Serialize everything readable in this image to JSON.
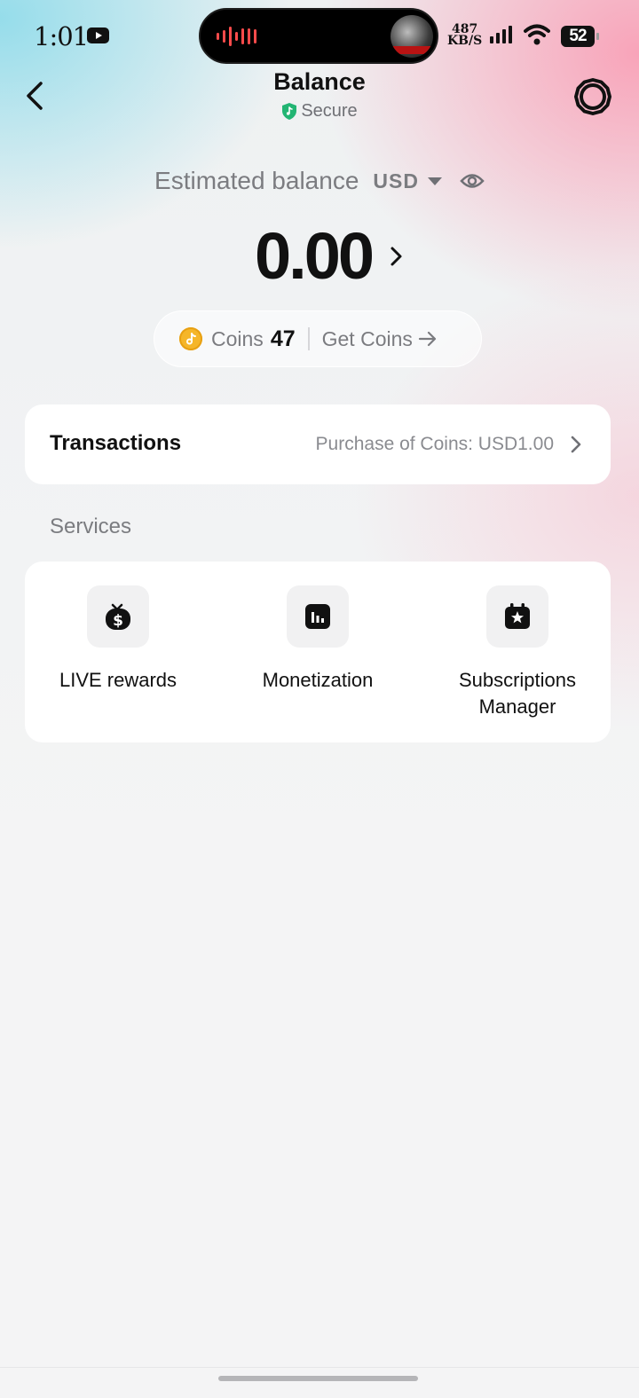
{
  "status_bar": {
    "time": "1:01",
    "network_speed": "487 KB/S",
    "network_speed_value": "487",
    "network_speed_unit": "KB/S",
    "battery": "52"
  },
  "header": {
    "title": "Balance",
    "secure_label": "Secure"
  },
  "balance": {
    "estimated_label": "Estimated balance",
    "currency": "USD",
    "amount": "0.00"
  },
  "coins": {
    "label": "Coins",
    "count": "47",
    "get_coins_label": "Get Coins"
  },
  "transactions": {
    "title": "Transactions",
    "latest": "Purchase of Coins: USD1.00"
  },
  "services": {
    "title": "Services",
    "items": [
      {
        "label": "LIVE rewards",
        "icon": "live-rewards-icon"
      },
      {
        "label": "Monetization",
        "icon": "monetization-icon"
      },
      {
        "label": "Subscriptions Manager",
        "icon": "subscriptions-manager-icon"
      }
    ]
  },
  "colors": {
    "secure_green": "#22b573",
    "coin_gold": "#f5b62a",
    "text_primary": "#111111",
    "text_secondary": "#7b7c80"
  }
}
